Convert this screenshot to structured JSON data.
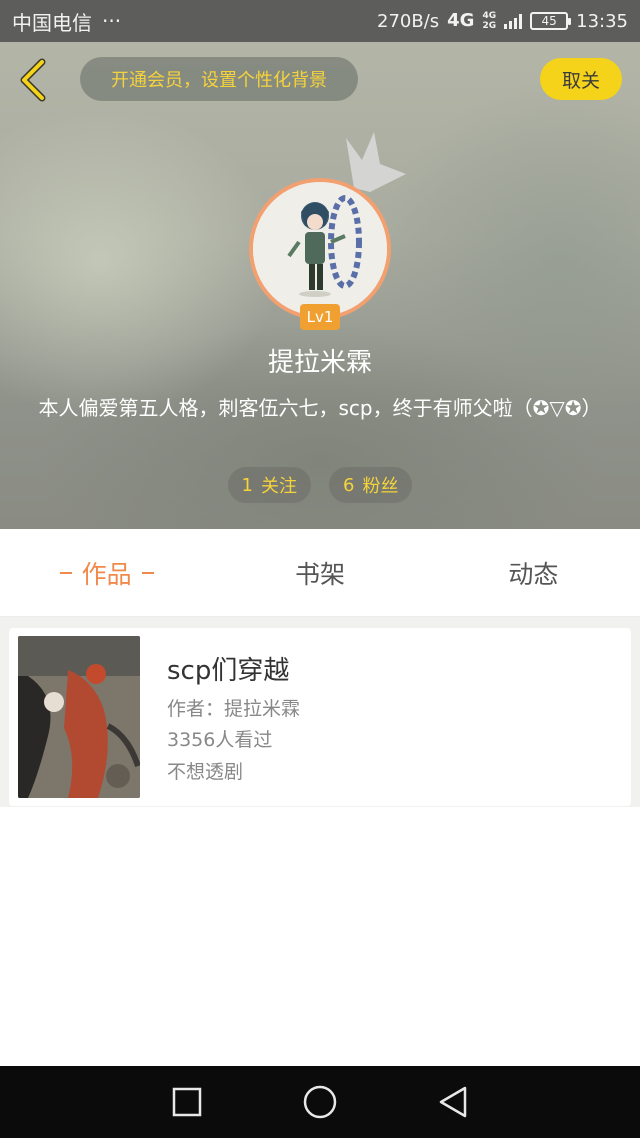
{
  "status_bar": {
    "carrier": "中国电信",
    "more": "···",
    "speed": "270B/s",
    "net_primary": "4G",
    "net_secondary_top": "4G",
    "net_secondary_bottom": "2G",
    "battery": "45",
    "time": "13:35"
  },
  "header": {
    "back_icon": "chevron-left-icon",
    "vip_text": "开通会员，设置个性化背景",
    "unfollow_label": "取关",
    "level": "Lv1",
    "username": "提拉米霖",
    "bio": "本人偏爱第五人格，刺客伍六七，scp，终于有师父啦（✪▽✪）",
    "following_count": "1",
    "following_label": "关注",
    "fans_count": "6",
    "fans_label": "粉丝"
  },
  "tabs": [
    {
      "label": "作品",
      "active": true
    },
    {
      "label": "书架",
      "active": false
    },
    {
      "label": "动态",
      "active": false
    }
  ],
  "works": [
    {
      "title": "scp们穿越",
      "author": "作者：提拉米霖",
      "views": "3356人看过",
      "description": "不想透剧"
    }
  ],
  "nav": {
    "recents_icon": "square-icon",
    "home_icon": "circle-icon",
    "back_icon": "triangle-back-icon"
  },
  "colors": {
    "accent_orange": "#f08a4b",
    "accent_yellow": "#f5d31a",
    "status_bar": "#5d5d5b"
  }
}
